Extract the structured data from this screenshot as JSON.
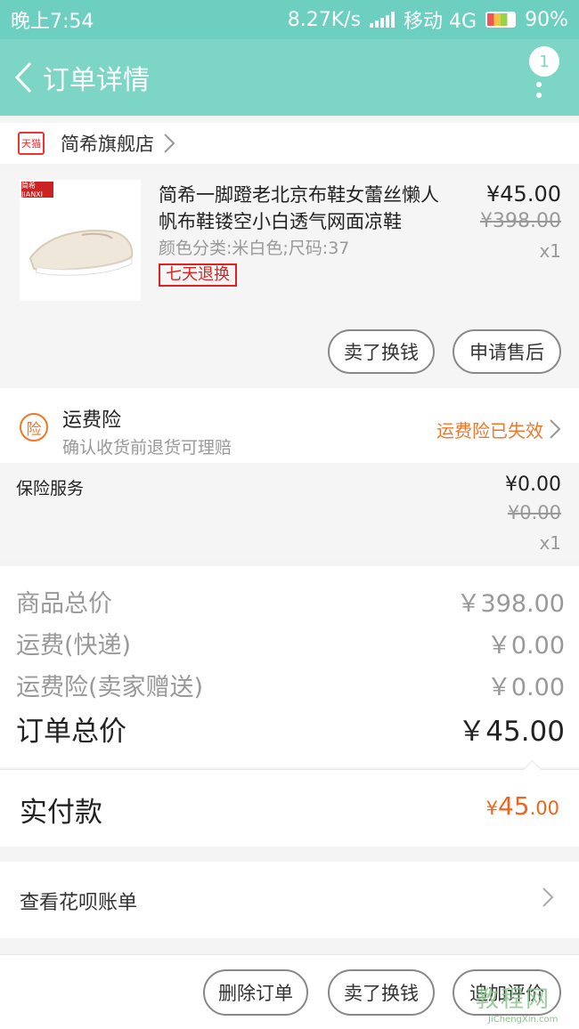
{
  "status_bar": {
    "time": "晚上7:54",
    "speed": "8.27K/s",
    "carrier": "移动 4G",
    "battery": "90%"
  },
  "header": {
    "title": "订单详情",
    "badge": "1"
  },
  "store": {
    "badge": "天猫",
    "name": "简希旗舰店"
  },
  "product": {
    "logo": "简希 JIANXI",
    "name": "简希一脚蹬老北京布鞋女蕾丝懒人帆布鞋镂空小白透气网面凉鞋",
    "spec": "颜色分类:米白色;尺码:37",
    "tag": "七天退换",
    "price": "¥45.00",
    "original_price": "¥398.00",
    "quantity": "x1",
    "sell_button": "卖了换钱",
    "after_sale_button": "申请售后"
  },
  "insurance": {
    "icon": "险",
    "title": "运费险",
    "subtitle": "确认收货前退货可理赔",
    "status": "运费险已失效"
  },
  "service": {
    "label": "保险服务",
    "price": "¥0.00",
    "original_price": "¥0.00",
    "quantity": "x1"
  },
  "summary": {
    "rows": [
      {
        "label": "商品总价",
        "value": "￥398.00"
      },
      {
        "label": "运费(快递)",
        "value": "￥0.00"
      },
      {
        "label": "运费险(卖家赠送)",
        "value": "￥0.00"
      }
    ],
    "total_label": "订单总价",
    "total_value": "￥45.00"
  },
  "paid": {
    "label": "实付款",
    "currency": "¥",
    "amount_main": "45",
    "amount_decimal": ".00"
  },
  "huabei": {
    "label": "查看花呗账单"
  },
  "bottom": {
    "delete": "删除订单",
    "sell": "卖了换钱",
    "review": "追加评价"
  },
  "watermark": {
    "text": "教程网",
    "url": "JiChengXin.com"
  },
  "colors": {
    "header": "#7dd5c6",
    "accent": "#f0651e"
  }
}
